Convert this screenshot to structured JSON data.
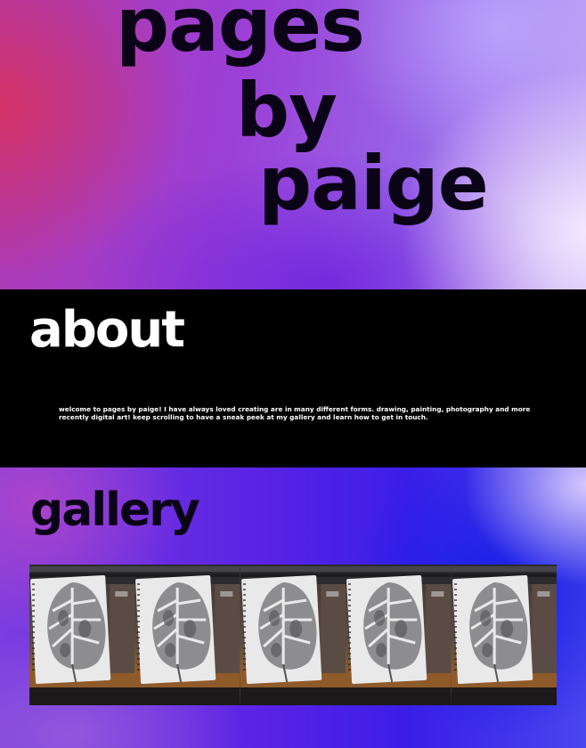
{
  "hero": {
    "title_lines": [
      "pages",
      "by",
      "paige"
    ]
  },
  "about": {
    "heading": "about",
    "text": "welcome to pages by paige! I have always loved creating are in many different forms. drawing, painting, photography and more recently digital art! keep scrolling to have a sneak peek at my gallery and learn how to get in touch."
  },
  "gallery": {
    "heading": "gallery",
    "images": [
      {
        "icon": "monstera-leaf-sketchbook-photo"
      },
      {
        "icon": "monstera-leaf-sketchbook-photo"
      },
      {
        "icon": "monstera-leaf-sketchbook-photo"
      },
      {
        "icon": "monstera-leaf-sketchbook-photo"
      },
      {
        "icon": "monstera-leaf-sketchbook-photo"
      }
    ]
  },
  "colors": {
    "text_dark": "#0b0416",
    "about_bg": "#000000",
    "text_light": "#ffffff"
  }
}
